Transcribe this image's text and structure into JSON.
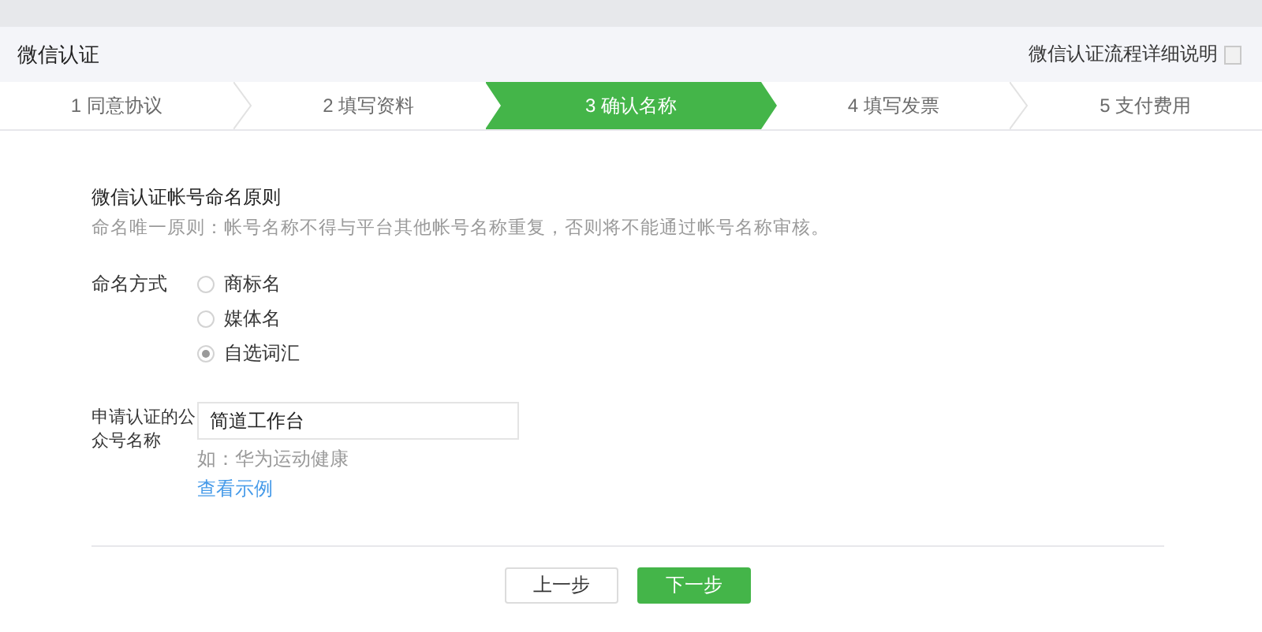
{
  "header": {
    "title": "微信认证",
    "help_link": "微信认证流程详细说明"
  },
  "steps": [
    {
      "label": "1 同意协议",
      "selected": false
    },
    {
      "label": "2 填写资料",
      "selected": false
    },
    {
      "label": "3 确认名称",
      "selected": true
    },
    {
      "label": "4 填写发票",
      "selected": false
    },
    {
      "label": "5 支付费用",
      "selected": false
    }
  ],
  "rules": {
    "title": "微信认证帐号命名原则",
    "text": "命名唯一原则：帐号名称不得与平台其他帐号名称重复，否则将不能通过帐号名称审核。"
  },
  "naming": {
    "label": "命名方式",
    "options": [
      {
        "label": "商标名",
        "selected": false
      },
      {
        "label": "媒体名",
        "selected": false
      },
      {
        "label": "自选词汇",
        "selected": true
      }
    ]
  },
  "name_field": {
    "label": "申请认证的公众号名称",
    "value": "简道工作台",
    "hint": "如：华为运动健康",
    "example_link": "查看示例"
  },
  "buttons": [
    {
      "label": "上一步",
      "kind": "secondary"
    },
    {
      "label": "下一步",
      "kind": "primary"
    }
  ]
}
